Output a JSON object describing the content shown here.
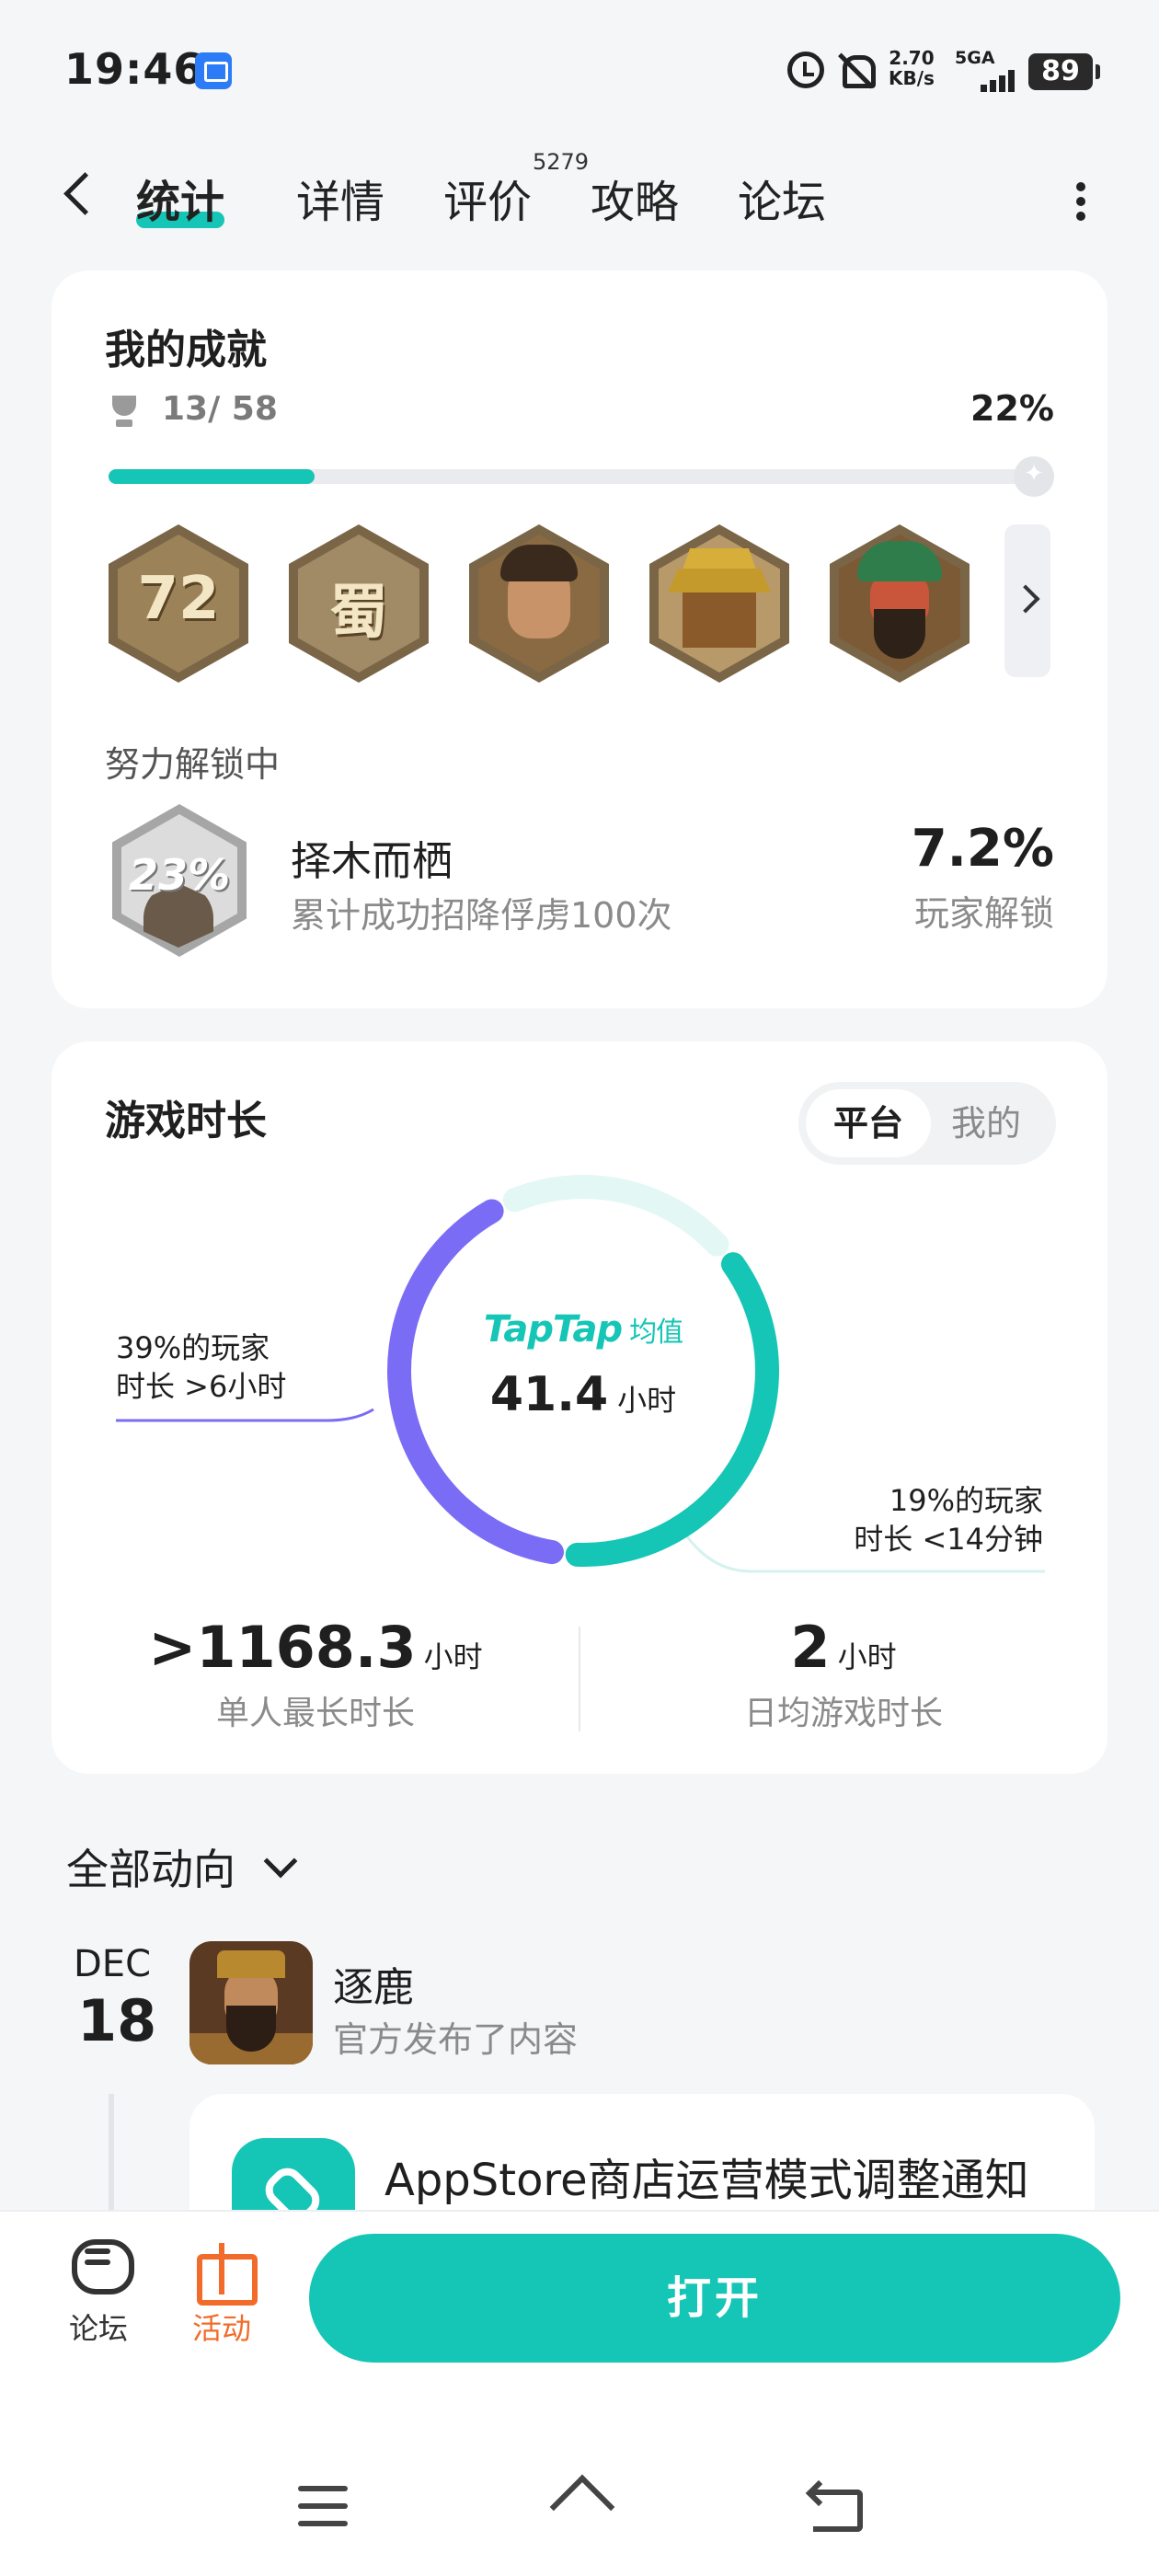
{
  "status_bar": {
    "time": "19:46",
    "net_speed": "2.70",
    "net_unit": "KB/s",
    "signal": "5GA",
    "battery": "89"
  },
  "tabs": [
    {
      "label": "统计"
    },
    {
      "label": "详情"
    },
    {
      "label": "评价",
      "count": "5279"
    },
    {
      "label": "攻略"
    },
    {
      "label": "论坛"
    }
  ],
  "achievements": {
    "title": "我的成就",
    "unlocked": "13/ 58",
    "percent_label": "22%",
    "progress": 0.22,
    "badges": [
      {
        "name": "72h-badge",
        "text": "72"
      },
      {
        "name": "shu-badge",
        "text": "蜀"
      },
      {
        "name": "general-badge",
        "text": ""
      },
      {
        "name": "palace-badge",
        "text": ""
      },
      {
        "name": "guan-yu-badge",
        "text": ""
      }
    ],
    "in_progress_title": "努力解锁中",
    "in_progress": {
      "badge_pct": "23%",
      "name": "择木而栖",
      "desc": "累计成功招降俘虏100次",
      "player_pct": "7.2%",
      "player_label": "玩家解锁"
    }
  },
  "playtime": {
    "title": "游戏时长",
    "toggle": {
      "platform": "平台",
      "mine": "我的"
    },
    "brand": "TapTap",
    "avg_label": "均值",
    "avg_value": "41.4",
    "unit_hours": "小时",
    "left_callout": [
      "39%的玩家",
      "时长 >6小时"
    ],
    "right_callout": [
      "19%的玩家",
      "时长 <14分钟"
    ],
    "donut": {
      "over_6h_pct": 39,
      "under_14m_pct": 19,
      "colors": {
        "teal": "#15c5b5",
        "purple": "#7b6cf6",
        "light": "#e3f7f5"
      }
    },
    "max_session": ">1168.3",
    "max_session_label": "单人最长时长",
    "daily_avg": "2",
    "daily_avg_label": "日均游戏时长"
  },
  "feed": {
    "filter_label": "全部动向",
    "date_month": "DEC",
    "date_day": "18",
    "author": "逐鹿",
    "meta": "官方发布了内容",
    "post_title": "AppStore商店运营模式调整通知"
  },
  "bottom_bar": {
    "forum": "论坛",
    "event": "活动",
    "open": "打开"
  },
  "colors": {
    "accent": "#15c5b5",
    "event": "#f26b2a"
  }
}
